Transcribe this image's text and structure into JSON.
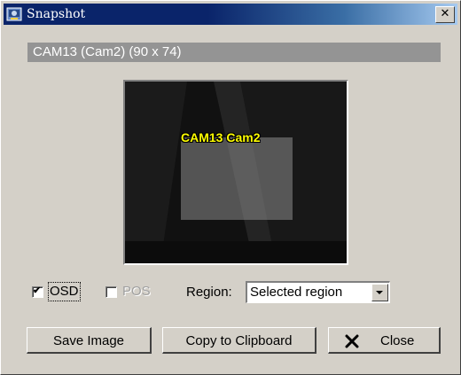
{
  "window": {
    "title": "Snapshot"
  },
  "info": {
    "text": "CAM13 (Cam2) (90 x 74)"
  },
  "preview": {
    "osd_text": "CAM13 Cam2"
  },
  "options": {
    "osd": {
      "label": "OSD",
      "checked": true
    },
    "pos": {
      "label": "POS",
      "checked": false
    },
    "region_label": "Region:",
    "region_value": "Selected region"
  },
  "buttons": {
    "save": "Save Image",
    "copy": "Copy to Clipboard",
    "close": "Close"
  },
  "icons": {
    "title": "snapshot-app-icon",
    "close": "close-x-icon",
    "checkmark": "checkmark-icon",
    "dropdown": "chevron-down-icon",
    "close_button": "x-mark-icon"
  }
}
